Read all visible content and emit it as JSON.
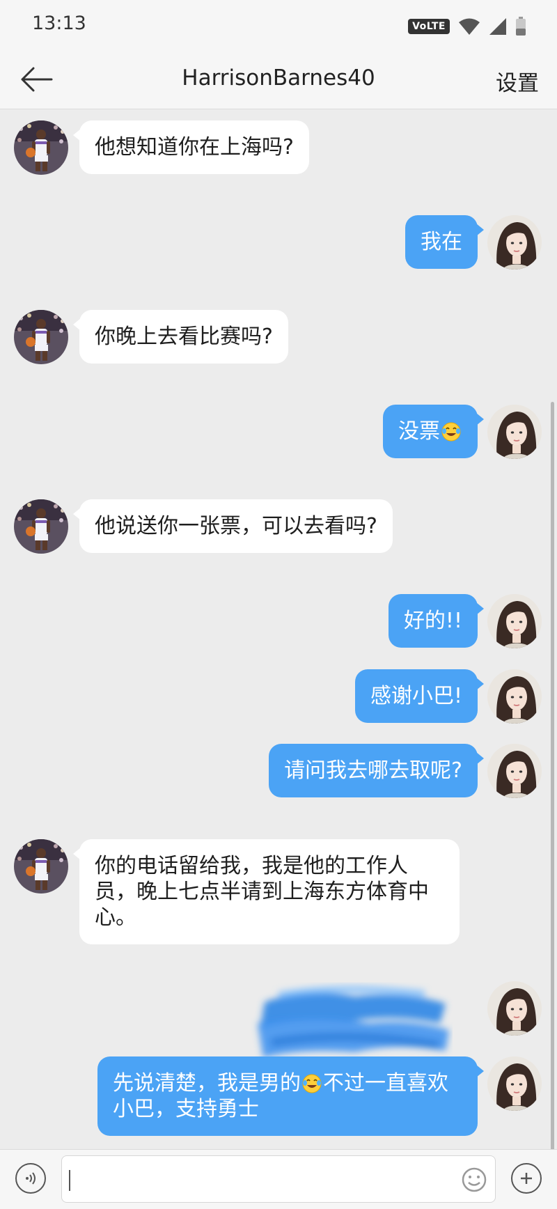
{
  "status_bar": {
    "time": "13:13",
    "network_badge": "VoLTE",
    "icons": [
      "wifi-icon",
      "signal-icon",
      "battery-icon"
    ]
  },
  "header": {
    "title": "HarrisonBarnes40",
    "settings_label": "设置",
    "back_icon": "arrow-left-icon"
  },
  "colors": {
    "outgoing_bubble": "#4ba3f5",
    "incoming_bubble": "#ffffff",
    "background": "#ececec",
    "redaction": "#2f86e6"
  },
  "messages": [
    {
      "side": "in",
      "text": "他想知道你在上海吗?"
    },
    {
      "side": "out",
      "text": "我在"
    },
    {
      "side": "in",
      "text": "你晚上去看比赛吗?"
    },
    {
      "side": "out",
      "text": "没票",
      "emoji_after": "tears-of-joy-emoji"
    },
    {
      "side": "in",
      "text": "他说送你一张票，可以去看吗?"
    },
    {
      "side": "out",
      "text": "好的!!"
    },
    {
      "side": "out",
      "text": "感谢小巴!"
    },
    {
      "side": "out",
      "text": "请问我去哪去取呢?"
    },
    {
      "side": "in",
      "text_lines": [
        "你的电话留给我，我是他的工作人",
        "员，晚上七点半请到上海东方体育中",
        "心。"
      ]
    },
    {
      "side": "out",
      "redacted": true
    },
    {
      "side": "out",
      "text_part1": "先说清楚，我是男的",
      "emoji_mid": "tears-of-joy-emoji",
      "text_part2": "不过一直喜欢",
      "text_line2": "小巴，支持勇士"
    }
  ],
  "input_bar": {
    "placeholder": "",
    "voice_icon": "voice-icon",
    "emoji_icon": "smiley-icon",
    "plus_icon": "plus-icon"
  }
}
